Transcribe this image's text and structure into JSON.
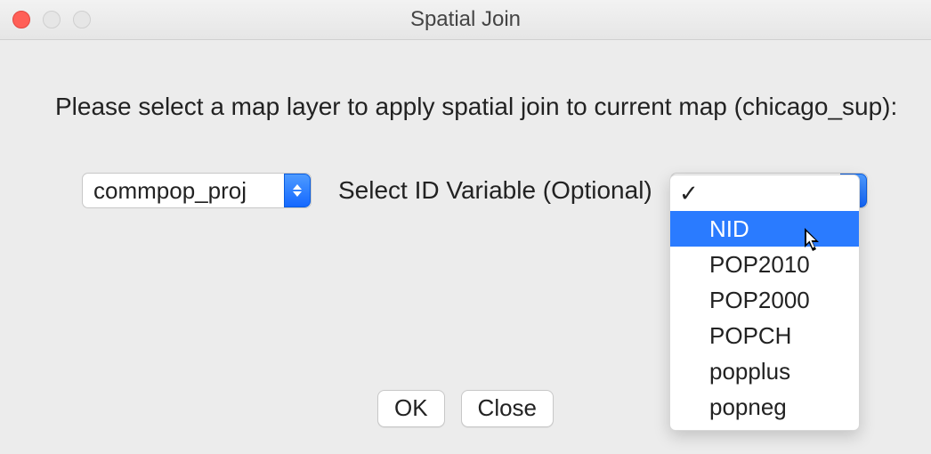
{
  "window": {
    "title": "Spatial Join"
  },
  "prompt": "Please select a map layer to apply spatial join to current map (chicago_sup):",
  "layer_select": {
    "value": "commpop_proj"
  },
  "id_label": "Select ID Variable (Optional)",
  "id_menu": {
    "current": "",
    "highlighted": "NID",
    "items": [
      "",
      "NID",
      "POP2010",
      "POP2000",
      "POPCH",
      "popplus",
      "popneg"
    ]
  },
  "buttons": {
    "ok": "OK",
    "close": "Close"
  }
}
